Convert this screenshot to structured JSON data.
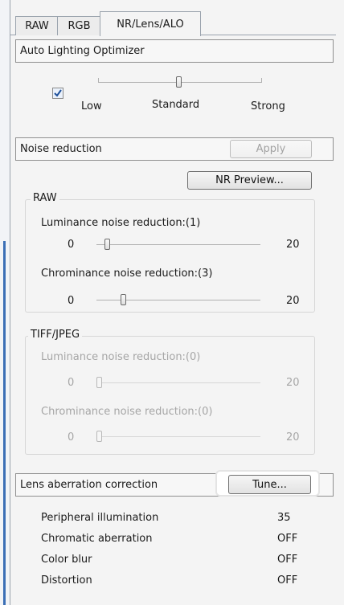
{
  "tabs": [
    {
      "label": "RAW"
    },
    {
      "label": "RGB"
    },
    {
      "label": "NR/Lens/ALO",
      "active": true
    }
  ],
  "alo": {
    "header": "Auto Lighting Optimizer",
    "checkbox_checked": true,
    "slider_labels": {
      "low": "Low",
      "standard": "Standard",
      "strong": "Strong"
    },
    "level": "Standard"
  },
  "noise": {
    "header": "Noise reduction",
    "apply_label": "Apply",
    "preview_label": "NR Preview...",
    "raw": {
      "legend": "RAW",
      "luminance_label": "Luminance noise reduction:(1)",
      "luminance_value": 1,
      "chrominance_label": "Chrominance noise reduction:(3)",
      "chrominance_value": 3,
      "min": "0",
      "max": "20"
    },
    "tiff": {
      "legend": "TIFF/JPEG",
      "luminance_label": "Luminance noise reduction:(0)",
      "luminance_value": 0,
      "chrominance_label": "Chrominance noise reduction:(0)",
      "chrominance_value": 0,
      "min": "0",
      "max": "20"
    }
  },
  "lens": {
    "header": "Lens aberration correction",
    "tune_label": "Tune...",
    "items": [
      {
        "label": "Peripheral illumination",
        "value": "35"
      },
      {
        "label": "Chromatic aberration",
        "value": "OFF"
      },
      {
        "label": "Color blur",
        "value": "OFF"
      },
      {
        "label": "Distortion",
        "value": "OFF"
      }
    ]
  }
}
